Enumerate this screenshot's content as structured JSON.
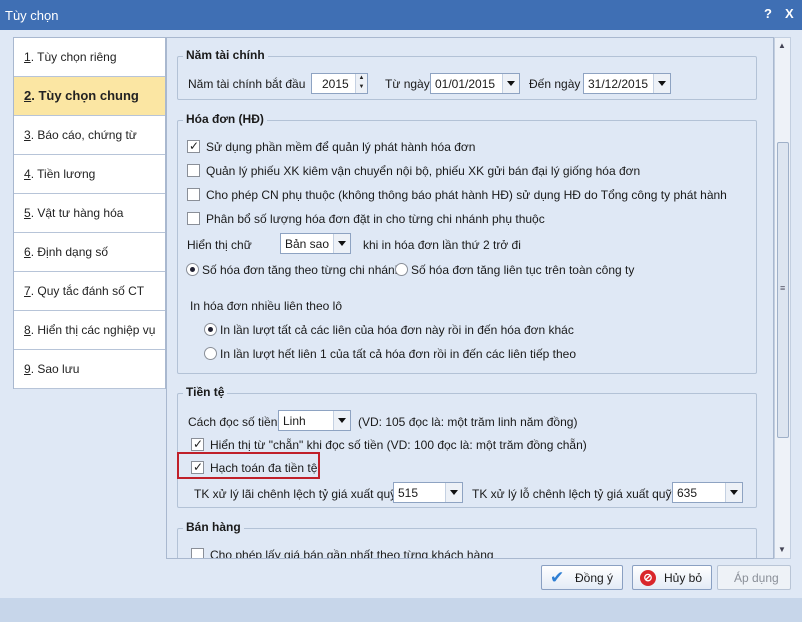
{
  "window": {
    "title": "Tùy chọn",
    "help": "?",
    "close": "X"
  },
  "sidebar": {
    "items": [
      {
        "num": "1",
        "label": ". Tùy chọn riêng"
      },
      {
        "num": "2",
        "label": ". Tùy chọn chung"
      },
      {
        "num": "3",
        "label": ". Báo cáo, chứng từ"
      },
      {
        "num": "4",
        "label": ". Tiền lương"
      },
      {
        "num": "5",
        "label": ". Vật tư hàng hóa"
      },
      {
        "num": "6",
        "label": ". Định dạng số"
      },
      {
        "num": "7",
        "label": ". Quy tắc đánh số CT"
      },
      {
        "num": "8",
        "label": ". Hiển thị các nghiệp vụ"
      },
      {
        "num": "9",
        "label": ". Sao lưu"
      }
    ],
    "active_index": 1
  },
  "fiscal": {
    "title": "Năm tài chính",
    "start_label": "Năm tài chính bắt đầu",
    "year": "2015",
    "from_label": "Từ ngày",
    "from_date": "01/01/2015",
    "to_label": "Đến ngày",
    "to_date": "31/12/2015"
  },
  "invoice": {
    "title": "Hóa đơn (HĐ)",
    "options": [
      {
        "label": "Sử dụng phần mềm để quản lý phát hành hóa đơn",
        "checked": true
      },
      {
        "label": "Quản lý phiếu XK kiêm vận chuyển nội bộ, phiếu XK gửi bán đại lý giống hóa đơn",
        "checked": false
      },
      {
        "label": "Cho phép CN phụ thuộc (không thông báo phát hành HĐ) sử dụng HĐ do Tổng công ty phát hành",
        "checked": false
      },
      {
        "label": "Phân bổ số lượng hóa đơn đặt in cho từng chi nhánh phụ thuộc",
        "checked": false
      }
    ],
    "display_label": "Hiển thị chữ",
    "display_value": "Bản sao",
    "display_suffix": "khi in hóa đơn lần thứ 2 trở đi",
    "numbering": [
      {
        "label": "Số hóa đơn tăng theo từng chi nhánh",
        "checked": true
      },
      {
        "label": "Số hóa đơn tăng liên tục trên toàn công ty",
        "checked": false
      }
    ],
    "multi_label": "In hóa đơn nhiều liên theo lô",
    "print_modes": [
      {
        "label": "In lần lượt tất cả các liên của hóa đơn này rồi in đến hóa đơn khác",
        "checked": true
      },
      {
        "label": "In lần lượt hết liên 1 của tất cả hóa đơn rồi in đến các liên tiếp theo",
        "checked": false
      }
    ]
  },
  "currency": {
    "title": "Tiền tệ",
    "read_label": "Cách đọc số tiền",
    "read_value": "Linh",
    "read_example": "(VD: 105 đọc là: một trăm linh năm đồng)",
    "show_chan": {
      "label": "Hiển thị từ \"chẵn\" khi đọc số tiền (VD: 100 đọc là: một trăm đồng chẵn)",
      "checked": true
    },
    "multi_currency": {
      "label": "Hạch toán đa tiền tệ",
      "checked": true
    },
    "gain_label": "TK xử lý lãi chênh lệch tỷ giá xuất quỹ",
    "gain_value": "515",
    "loss_label": "TK xử lý lỗ chênh lệch tỷ giá xuất quỹ",
    "loss_value": "635"
  },
  "sales": {
    "title": "Bán hàng",
    "option": {
      "label": "Cho phép lấy giá bán gần nhất theo từng khách hàng",
      "checked": false
    }
  },
  "buttons": {
    "ok": "Đồng ý",
    "cancel": "Hủy bỏ",
    "apply": "Áp dụng"
  },
  "colors": {
    "titlebar": "#3f6fb4",
    "active_nav": "#fbe6a3",
    "highlight": "#c0202a"
  }
}
